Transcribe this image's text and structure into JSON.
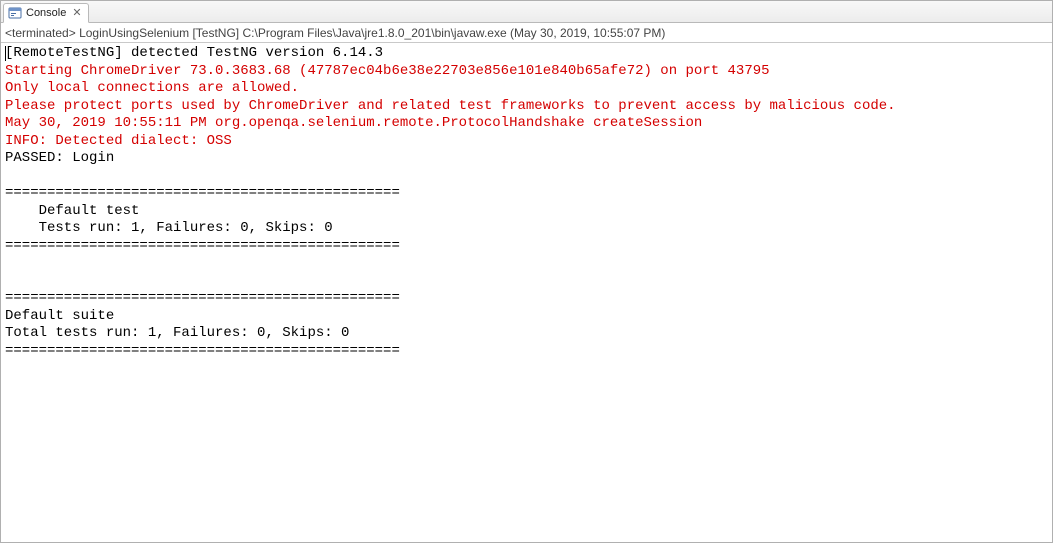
{
  "tab": {
    "label": "Console",
    "close_glyph": "✕"
  },
  "status": {
    "prefix": "<terminated>",
    "config": "LoginUsingSelenium [TestNG]",
    "path": "C:\\Program Files\\Java\\jre1.8.0_201\\bin\\javaw.exe",
    "timestamp": "(May 30, 2019, 10:55:07 PM)"
  },
  "console": {
    "lines": [
      {
        "cls": "black-line",
        "caret": true,
        "text": "[RemoteTestNG] detected TestNG version 6.14.3"
      },
      {
        "cls": "red-line",
        "text": "Starting ChromeDriver 73.0.3683.68 (47787ec04b6e38e22703e856e101e840b65afe72) on port 43795"
      },
      {
        "cls": "red-line",
        "text": "Only local connections are allowed."
      },
      {
        "cls": "red-line",
        "text": "Please protect ports used by ChromeDriver and related test frameworks to prevent access by malicious code."
      },
      {
        "cls": "red-line",
        "text": "May 30, 2019 10:55:11 PM org.openqa.selenium.remote.ProtocolHandshake createSession"
      },
      {
        "cls": "red-line",
        "text": "INFO: Detected dialect: OSS"
      },
      {
        "cls": "black-line",
        "text": "PASSED: Login"
      },
      {
        "cls": "black-line",
        "text": ""
      },
      {
        "cls": "black-line",
        "text": "==============================================="
      },
      {
        "cls": "black-line",
        "text": "    Default test"
      },
      {
        "cls": "black-line",
        "text": "    Tests run: 1, Failures: 0, Skips: 0"
      },
      {
        "cls": "black-line",
        "text": "==============================================="
      },
      {
        "cls": "black-line",
        "text": ""
      },
      {
        "cls": "black-line",
        "text": ""
      },
      {
        "cls": "black-line",
        "text": "==============================================="
      },
      {
        "cls": "black-line",
        "text": "Default suite"
      },
      {
        "cls": "black-line",
        "text": "Total tests run: 1, Failures: 0, Skips: 0"
      },
      {
        "cls": "black-line",
        "text": "==============================================="
      },
      {
        "cls": "black-line",
        "text": ""
      }
    ]
  }
}
